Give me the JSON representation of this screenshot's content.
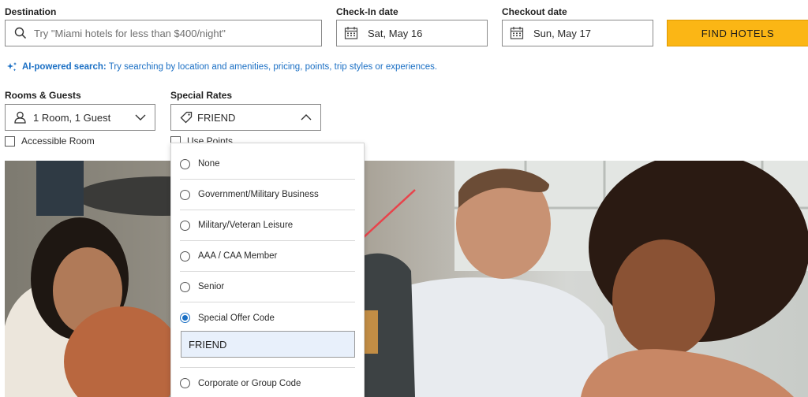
{
  "search": {
    "destination_label": "Destination",
    "destination_placeholder": "Try \"Miami hotels for less than $400/night\"",
    "checkin_label": "Check-In date",
    "checkin_value": "Sat, May 16",
    "checkout_label": "Checkout date",
    "checkout_value": "Sun, May 17",
    "find_button": "FIND HOTELS"
  },
  "ai_search": {
    "title": "AI-powered search:",
    "text": "Try searching by location and amenities, pricing, points, trip styles or experiences."
  },
  "rooms": {
    "label": "Rooms & Guests",
    "value": "1 Room, 1 Guest",
    "accessible_label": "Accessible Room"
  },
  "special_rates": {
    "label": "Special Rates",
    "value": "FRIEND",
    "points_label": "Use Points"
  },
  "dropdown": {
    "options": [
      {
        "label": "None",
        "selected": false
      },
      {
        "label": "Government/Military Business",
        "selected": false
      },
      {
        "label": "Military/Veteran Leisure",
        "selected": false
      },
      {
        "label": "AAA / CAA Member",
        "selected": false
      },
      {
        "label": "Senior",
        "selected": false
      },
      {
        "label": "Special Offer Code",
        "selected": true
      },
      {
        "label": "Corporate or Group Code",
        "selected": false
      }
    ],
    "code_value": "FRIEND"
  },
  "colors": {
    "accent": "#1a6fc4",
    "button": "#fbb615",
    "annotation_arrow": "#e8434b"
  }
}
